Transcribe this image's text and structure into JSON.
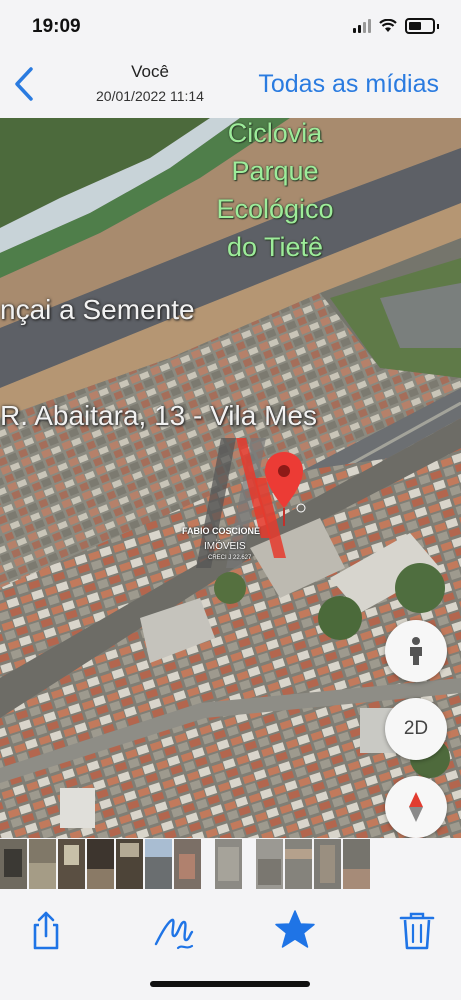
{
  "status": {
    "time": "19:09"
  },
  "nav": {
    "title": "Você",
    "subtitle": "20/01/2022 11:14",
    "all_media_label": "Todas as mídias"
  },
  "photo": {
    "park_label_lines": [
      "Ciclovia",
      "Parque",
      "Ecológico",
      "do Tietê"
    ],
    "place_label": "nçai a Semente",
    "street_label": "R. Abaitara, 13 - Vila Mes",
    "watermark": {
      "line1": "FABIO COSCIONE",
      "line2": "IMÓVEIS",
      "line3": "CRECI J 22.627"
    },
    "map_buttons": {
      "person_icon": "person-icon",
      "toggle_2d_label": "2D",
      "compass_icon": "compass-icon"
    }
  },
  "toolbar": {
    "icons": [
      "share-icon",
      "markup-icon",
      "favorite-star-icon",
      "trash-icon"
    ],
    "accent_color": "#1f74e6"
  }
}
